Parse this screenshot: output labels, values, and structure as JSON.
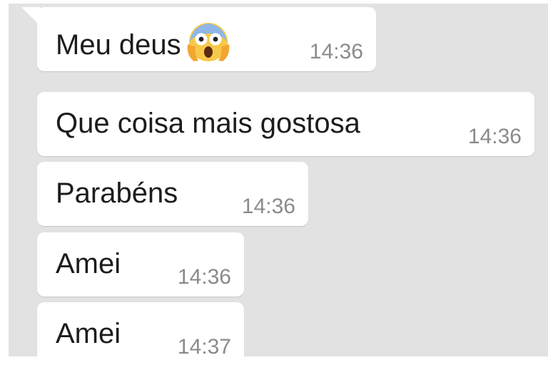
{
  "messages": [
    {
      "text": "Meu deus",
      "time": "14:36",
      "emoji": "screaming-in-fear-face"
    },
    {
      "text": "Que coisa mais gostosa",
      "time": "14:36"
    },
    {
      "text": "Parabéns",
      "time": "14:36"
    },
    {
      "text": "Amei",
      "time": "14:36"
    },
    {
      "text": "Amei",
      "time": "14:37"
    }
  ],
  "colors": {
    "chat_background": "#e2e2e2",
    "bubble": "#ffffff",
    "message_text": "#1c1c1c",
    "timestamp": "#8a8a8a"
  },
  "icons": {
    "emoji_0": "screaming-in-fear-emoji-icon"
  }
}
